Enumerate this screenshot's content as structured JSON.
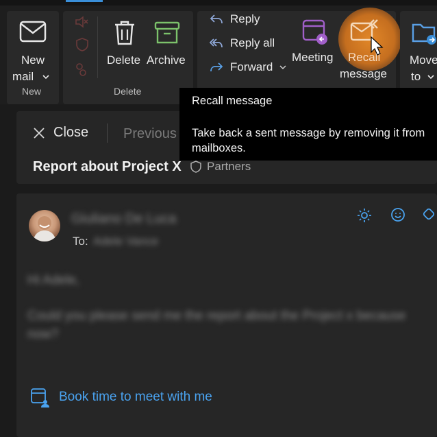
{
  "ribbon": {
    "new_mail": {
      "line1": "New",
      "line2": "mail",
      "group": "New"
    },
    "delete": {
      "label": "Delete"
    },
    "archive": {
      "label": "Archive"
    },
    "delete_group": "Delete",
    "reply": "Reply",
    "reply_all": "Reply all",
    "forward": "Forward",
    "meeting": "Meeting",
    "recall": {
      "line1": "Recall",
      "line2": "message"
    },
    "move": {
      "line1": "Move",
      "line2": "to"
    }
  },
  "tooltip": {
    "title": "Recall message",
    "desc_line1": "Take back a sent message by removing it from",
    "desc_line2": "mailboxes."
  },
  "reading": {
    "close": "Close",
    "previous": "Previous",
    "subject": "Report about Project X",
    "tag": "Partners"
  },
  "message": {
    "sender": "Giuliano De Luca",
    "to_label": "To:",
    "to": "Adele Vance",
    "greeting": "Hi Adele,",
    "body_line1": "Could you please send me the report about the Project x because",
    "body_line2": "now?",
    "book_link": "Book time to meet with me"
  },
  "colors": {
    "accent": "#3a8fd9",
    "link": "#4aa3f0",
    "recall_glow": "#e08a2c",
    "meeting_icon": "#a15fc9",
    "archive_icon": "#7cc26b"
  }
}
